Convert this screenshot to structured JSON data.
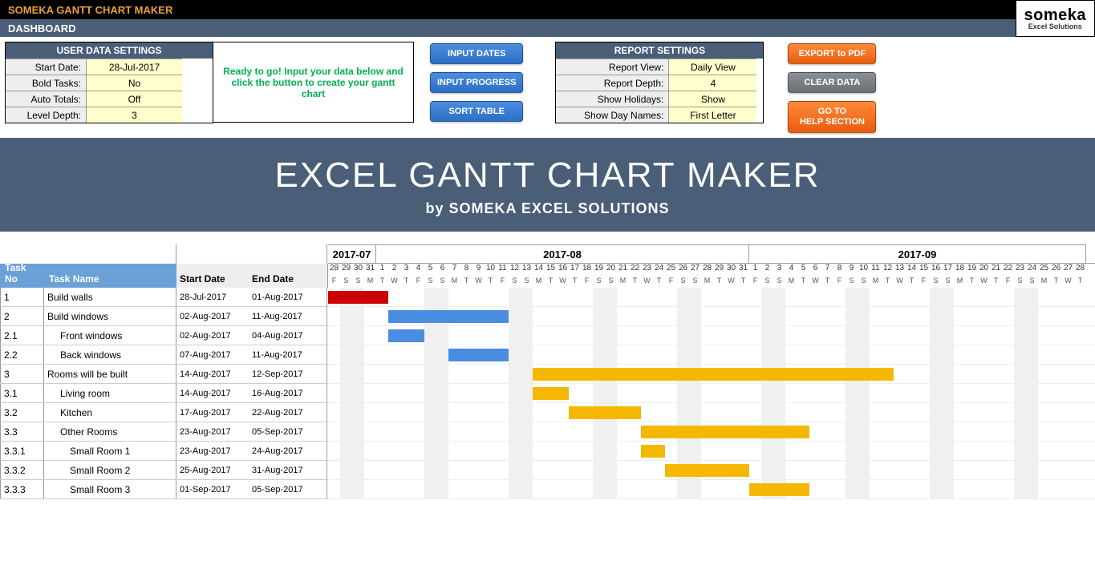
{
  "topbar": {
    "title": "SOMEKA GANTT CHART MAKER"
  },
  "logo": {
    "main": "someka",
    "sub": "Excel Solutions"
  },
  "dashbar": {
    "label": "DASHBOARD"
  },
  "user_settings": {
    "header": "USER DATA SETTINGS",
    "rows": [
      {
        "label": "Start Date:",
        "value": "28-Jul-2017"
      },
      {
        "label": "Bold Tasks:",
        "value": "No"
      },
      {
        "label": "Auto Totals:",
        "value": "Off"
      },
      {
        "label": "Level Depth:",
        "value": "3"
      }
    ]
  },
  "ready_msg": "Ready to go! Input your data below and click the button to create your gantt chart",
  "blue_buttons": {
    "input_dates": "INPUT DATES",
    "input_progress": "INPUT PROGRESS",
    "sort_table": "SORT TABLE"
  },
  "report_settings": {
    "header": "REPORT SETTINGS",
    "rows": [
      {
        "label": "Report View:",
        "value": "Daily View"
      },
      {
        "label": "Report Depth:",
        "value": "4"
      },
      {
        "label": "Show Holidays:",
        "value": "Show"
      },
      {
        "label": "Show Day Names:",
        "value": "First Letter"
      }
    ]
  },
  "action_buttons": {
    "export_pdf": "EXPORT to PDF",
    "clear_data": "CLEAR DATA",
    "help": "GO TO\nHELP SECTION"
  },
  "hero": {
    "title": "EXCEL GANTT CHART MAKER",
    "sub": "by SOMEKA EXCEL SOLUTIONS"
  },
  "task_headers": {
    "no": "Task No",
    "name": "Task Name",
    "start": "Start Date",
    "end": "End Date"
  },
  "months": [
    {
      "label": "2017-07",
      "days": 4
    },
    {
      "label": "2017-08",
      "days": 31
    },
    {
      "label": "2017-09",
      "days": 28
    }
  ],
  "day_numbers": [
    28,
    29,
    30,
    31,
    1,
    2,
    3,
    4,
    5,
    6,
    7,
    8,
    9,
    10,
    11,
    12,
    13,
    14,
    15,
    16,
    17,
    18,
    19,
    20,
    21,
    22,
    23,
    24,
    25,
    26,
    27,
    28,
    29,
    30,
    31,
    1,
    2,
    3,
    4,
    5,
    6,
    7,
    8,
    9,
    10,
    11,
    12,
    13,
    14,
    15,
    16,
    17,
    18,
    19,
    20,
    21,
    22,
    23,
    24,
    25,
    26,
    27,
    28
  ],
  "day_letters": [
    "F",
    "S",
    "S",
    "M",
    "T",
    "W",
    "T",
    "F",
    "S",
    "S",
    "M",
    "T",
    "W",
    "T",
    "F",
    "S",
    "S",
    "M",
    "T",
    "W",
    "T",
    "F",
    "S",
    "S",
    "M",
    "T",
    "W",
    "T",
    "F",
    "S",
    "S",
    "M",
    "T",
    "W",
    "T",
    "F",
    "S",
    "S",
    "M",
    "T",
    "W",
    "T",
    "F",
    "S",
    "S",
    "M",
    "T",
    "W",
    "T",
    "F",
    "S",
    "S",
    "M",
    "T",
    "W",
    "T",
    "F",
    "S",
    "S",
    "M",
    "T",
    "W",
    "T"
  ],
  "weekend_idx": [
    1,
    2,
    8,
    9,
    15,
    16,
    22,
    23,
    29,
    30,
    36,
    37,
    43,
    44,
    50,
    51,
    57,
    58
  ],
  "tasks": [
    {
      "no": "1",
      "name": "Build walls",
      "start": "28-Jul-2017",
      "end": "01-Aug-2017",
      "indent": 0,
      "bar_start": 0,
      "bar_len": 5,
      "color": "red"
    },
    {
      "no": "2",
      "name": "Build windows",
      "start": "02-Aug-2017",
      "end": "11-Aug-2017",
      "indent": 0,
      "bar_start": 5,
      "bar_len": 10,
      "color": "blue"
    },
    {
      "no": "2.1",
      "name": "Front windows",
      "start": "02-Aug-2017",
      "end": "04-Aug-2017",
      "indent": 1,
      "bar_start": 5,
      "bar_len": 3,
      "color": "blue"
    },
    {
      "no": "2.2",
      "name": "Back windows",
      "start": "07-Aug-2017",
      "end": "11-Aug-2017",
      "indent": 1,
      "bar_start": 10,
      "bar_len": 5,
      "color": "blue"
    },
    {
      "no": "3",
      "name": "Rooms will be built",
      "start": "14-Aug-2017",
      "end": "12-Sep-2017",
      "indent": 0,
      "bar_start": 17,
      "bar_len": 30,
      "color": "orange"
    },
    {
      "no": "3.1",
      "name": "Living room",
      "start": "14-Aug-2017",
      "end": "16-Aug-2017",
      "indent": 1,
      "bar_start": 17,
      "bar_len": 3,
      "color": "orange"
    },
    {
      "no": "3.2",
      "name": "Kitchen",
      "start": "17-Aug-2017",
      "end": "22-Aug-2017",
      "indent": 1,
      "bar_start": 20,
      "bar_len": 6,
      "color": "orange"
    },
    {
      "no": "3.3",
      "name": "Other Rooms",
      "start": "23-Aug-2017",
      "end": "05-Sep-2017",
      "indent": 1,
      "bar_start": 26,
      "bar_len": 14,
      "color": "orange"
    },
    {
      "no": "3.3.1",
      "name": "Small Room 1",
      "start": "23-Aug-2017",
      "end": "24-Aug-2017",
      "indent": 2,
      "bar_start": 26,
      "bar_len": 2,
      "color": "orange"
    },
    {
      "no": "3.3.2",
      "name": "Small Room 2",
      "start": "25-Aug-2017",
      "end": "31-Aug-2017",
      "indent": 2,
      "bar_start": 28,
      "bar_len": 7,
      "color": "orange"
    },
    {
      "no": "3.3.3",
      "name": "Small Room 3",
      "start": "01-Sep-2017",
      "end": "05-Sep-2017",
      "indent": 2,
      "bar_start": 35,
      "bar_len": 5,
      "color": "orange"
    }
  ],
  "chart_data": {
    "type": "bar",
    "title": "Gantt Timeline (Daily View)",
    "x_start": "2017-07-28",
    "series": [
      {
        "name": "Build walls",
        "start": "2017-07-28",
        "end": "2017-08-01",
        "color": "#cc0000"
      },
      {
        "name": "Build windows",
        "start": "2017-08-02",
        "end": "2017-08-11",
        "color": "#4a8de0"
      },
      {
        "name": "Front windows",
        "start": "2017-08-02",
        "end": "2017-08-04",
        "color": "#4a8de0"
      },
      {
        "name": "Back windows",
        "start": "2017-08-07",
        "end": "2017-08-11",
        "color": "#4a8de0"
      },
      {
        "name": "Rooms will be built",
        "start": "2017-08-14",
        "end": "2017-09-12",
        "color": "#f5b800"
      },
      {
        "name": "Living room",
        "start": "2017-08-14",
        "end": "2017-08-16",
        "color": "#f5b800"
      },
      {
        "name": "Kitchen",
        "start": "2017-08-17",
        "end": "2017-08-22",
        "color": "#f5b800"
      },
      {
        "name": "Other Rooms",
        "start": "2017-08-23",
        "end": "2017-09-05",
        "color": "#f5b800"
      },
      {
        "name": "Small Room 1",
        "start": "2017-08-23",
        "end": "2017-08-24",
        "color": "#f5b800"
      },
      {
        "name": "Small Room 2",
        "start": "2017-08-25",
        "end": "2017-08-31",
        "color": "#f5b800"
      },
      {
        "name": "Small Room 3",
        "start": "2017-09-01",
        "end": "2017-09-05",
        "color": "#f5b800"
      }
    ]
  }
}
